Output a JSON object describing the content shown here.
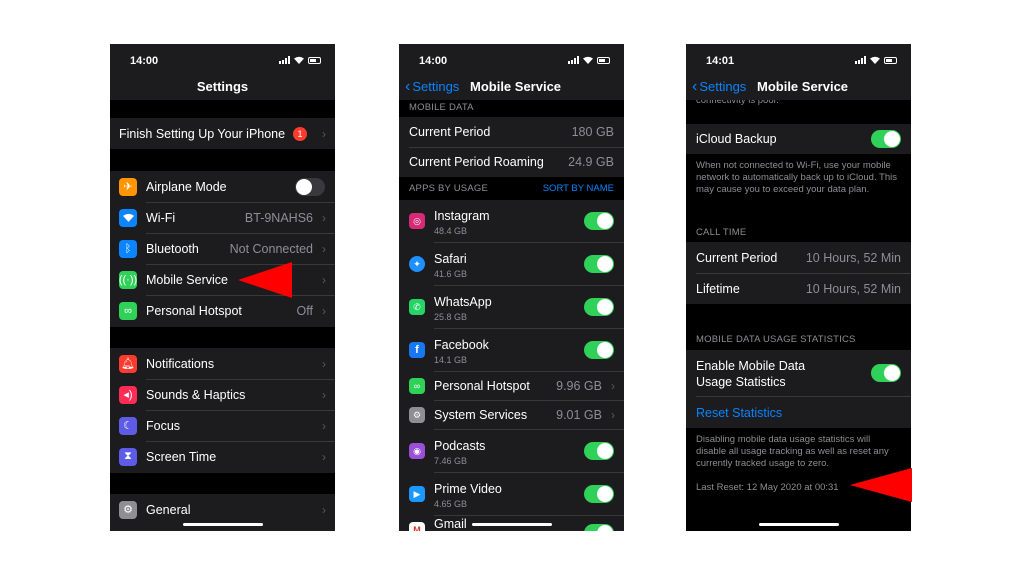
{
  "colors": {
    "accent": "#0a84ff",
    "toggle_on": "#30d158",
    "arrow": "#ff0000"
  },
  "screen1": {
    "time": "14:00",
    "title": "Settings",
    "finish_setup": {
      "label": "Finish Setting Up Your iPhone",
      "badge": "1"
    },
    "group1": [
      {
        "label": "Airplane Mode",
        "icon": "airplane-icon",
        "color": "#ff9500"
      },
      {
        "label": "Wi-Fi",
        "value": "BT-9NAHS6",
        "icon": "wifi-icon",
        "color": "#0a84ff"
      },
      {
        "label": "Bluetooth",
        "value": "Not Connected",
        "icon": "bluetooth-icon",
        "color": "#0a84ff"
      },
      {
        "label": "Mobile Service",
        "icon": "antenna-icon",
        "color": "#30d158"
      },
      {
        "label": "Personal Hotspot",
        "value": "Off",
        "icon": "hotspot-icon",
        "color": "#30d158"
      }
    ],
    "group2": [
      {
        "label": "Notifications",
        "icon": "bell-icon",
        "color": "#ff3b30"
      },
      {
        "label": "Sounds & Haptics",
        "icon": "speaker-icon",
        "color": "#ff2d55"
      },
      {
        "label": "Focus",
        "icon": "moon-icon",
        "color": "#5e5ce6"
      },
      {
        "label": "Screen Time",
        "icon": "hourglass-icon",
        "color": "#5e5ce6"
      }
    ],
    "group3": [
      {
        "label": "General",
        "icon": "gear-icon",
        "color": "#8e8e93"
      }
    ]
  },
  "screen2": {
    "time": "14:00",
    "back": "Settings",
    "title": "Mobile Service",
    "mobile_data_header": "MOBILE DATA",
    "current_period": {
      "label": "Current Period",
      "value": "180 GB"
    },
    "current_period_roaming": {
      "label": "Current Period Roaming",
      "value": "24.9 GB"
    },
    "apps_header": "APPS BY USAGE",
    "sort_by": "SORT BY NAME",
    "apps": [
      {
        "name": "Instagram",
        "usage": "48.4 GB",
        "icon": "instagram-icon",
        "color": "#d62976"
      },
      {
        "name": "Safari",
        "usage": "41.6 GB",
        "icon": "safari-icon",
        "color": "#1e90ff"
      },
      {
        "name": "WhatsApp",
        "usage": "25.8 GB",
        "icon": "whatsapp-icon",
        "color": "#25d366"
      },
      {
        "name": "Facebook",
        "usage": "14.1 GB",
        "icon": "facebook-icon",
        "color": "#1877f2"
      }
    ],
    "system_rows": [
      {
        "name": "Personal Hotspot",
        "value": "9.96 GB",
        "icon": "hotspot-icon",
        "color": "#30d158"
      },
      {
        "name": "System Services",
        "value": "9.01 GB",
        "icon": "gear-icon",
        "color": "#8e8e93"
      }
    ],
    "apps2": [
      {
        "name": "Podcasts",
        "usage": "7.46 GB",
        "icon": "podcasts-icon",
        "color": "#9b4fd6"
      },
      {
        "name": "Prime Video",
        "usage": "4.65 GB",
        "icon": "prime-video-icon",
        "color": "#1a98ff"
      },
      {
        "name": "Gmail",
        "usage": "",
        "icon": "gmail-icon",
        "color": "#ffffff"
      }
    ]
  },
  "screen3": {
    "time": "14:01",
    "back": "Settings",
    "title": "Mobile Service",
    "top_cut_text": "connectivity is poor.",
    "icloud_backup": "iCloud Backup",
    "icloud_note": "When not connected to Wi-Fi, use your mobile network to automatically back up to iCloud. This may cause you to exceed your data plan.",
    "call_time_header": "CALL TIME",
    "call_current": {
      "label": "Current Period",
      "value": "10 Hours, 52 Min"
    },
    "call_lifetime": {
      "label": "Lifetime",
      "value": "10 Hours, 52 Min"
    },
    "stats_header": "MOBILE DATA USAGE STATISTICS",
    "enable_stats_line1": "Enable Mobile Data",
    "enable_stats_line2": "Usage Statistics",
    "reset_statistics": "Reset Statistics",
    "disable_note": "Disabling mobile data usage statistics will disable all usage tracking as well as reset any currently tracked usage to zero.",
    "last_reset": "Last Reset: 12 May 2020 at 00:31"
  }
}
